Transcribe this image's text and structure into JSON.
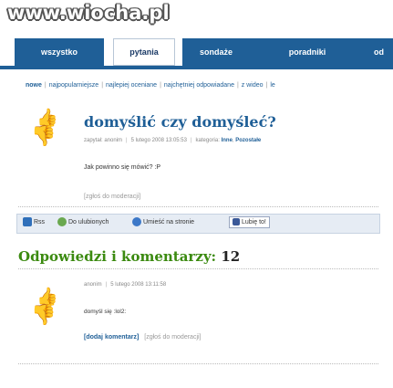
{
  "site": {
    "logo": "www.wiocha.pl"
  },
  "nav": {
    "tabs": [
      {
        "label": "wszystko"
      },
      {
        "label": "pytania"
      },
      {
        "label": "sondaże"
      },
      {
        "label": "poradniki"
      },
      {
        "label": "od"
      }
    ]
  },
  "subnav": {
    "items": [
      "nowe",
      "najpopularniejsze",
      "najlepiej oceniane",
      "najchętniej odpowiadane",
      "z wideo",
      "le"
    ]
  },
  "question": {
    "title": "domyślić czy domyśleć?",
    "meta_asked": "zapytał: anonim",
    "meta_date": "5 lutego 2008 13:05:53",
    "meta_category_label": "kategoria:",
    "category1": "Inne",
    "category_sep": ",",
    "category2": "Pozostałe",
    "body": "Jak powinno się mówić? :P",
    "report": "[zgłoś do moderacji]"
  },
  "share": {
    "rss": "Rss",
    "favorites": "Do ulubionych",
    "embed": "Umieść na stronie",
    "like": "Lubię to!"
  },
  "comments": {
    "heading": "Odpowiedzi i komentarzy:",
    "count": "12",
    "items": [
      {
        "author": "anonim",
        "date": "5 lutego 2008 13:11:58",
        "body": "domyśl się :lol2:",
        "add": "[dodaj komentarz]",
        "report": "[zgłoś do moderacji]"
      }
    ]
  },
  "colors": {
    "brand_blue": "#1f5f97",
    "green_heading": "#3b8a10"
  }
}
